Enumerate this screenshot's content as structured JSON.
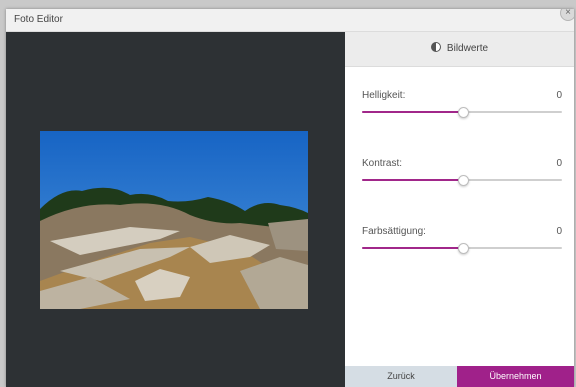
{
  "window": {
    "title": "Foto Editor",
    "close_glyph": "×"
  },
  "panel": {
    "header_icon": "contrast-icon",
    "header_label": "Bildwerte",
    "sliders": [
      {
        "id": "brightness",
        "label": "Helligkeit:",
        "value": "0",
        "level": 0.5
      },
      {
        "id": "contrast",
        "label": "Kontrast:",
        "value": "0",
        "level": 0.5
      },
      {
        "id": "saturation",
        "label": "Farbsättigung:",
        "value": "0",
        "level": 0.5
      }
    ],
    "back_label": "Zurück",
    "apply_label": "Übernehmen"
  },
  "colors": {
    "accent": "#a1278a",
    "preview_bg": "#2d3134",
    "back_button": "#d5dde4"
  }
}
